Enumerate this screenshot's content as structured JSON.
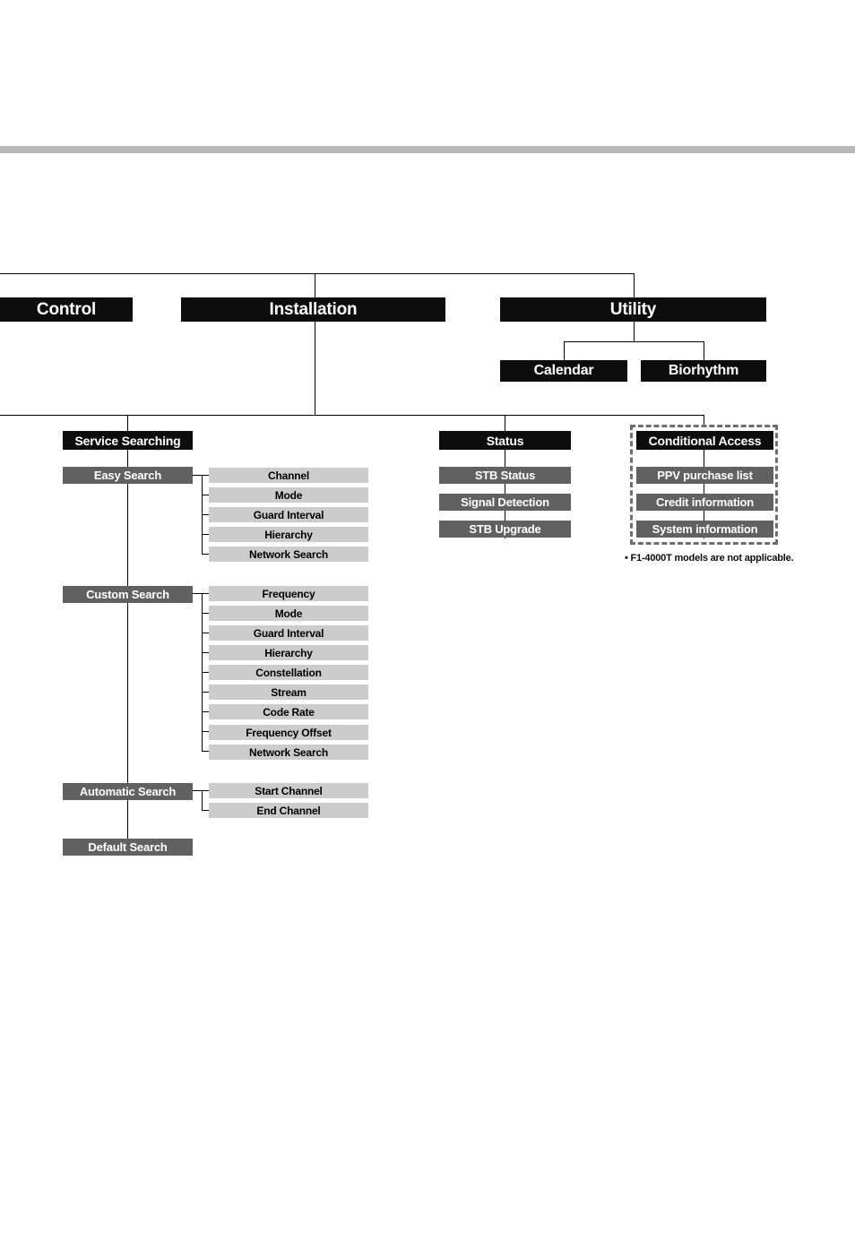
{
  "page": {
    "title": "Menu Structure Diagram",
    "colors": {
      "top_rule": "#b9b9b9",
      "node_black": "#0d0d0d",
      "node_dark_gray": "#616161",
      "node_light_gray": "#cccccc",
      "dashed_border": "#6e6e6e",
      "connector": "#000000"
    }
  },
  "top_level": {
    "control": "Control",
    "installation": "Installation",
    "utility": "Utility"
  },
  "utility_children": {
    "calendar": "Calendar",
    "biorhythm": "Biorhythm"
  },
  "installation": {
    "section_header": "Service Searching",
    "groups": [
      {
        "label": "Easy Search",
        "items": [
          "Channel",
          "Mode",
          "Guard Interval",
          "Hierarchy",
          "Network Search"
        ]
      },
      {
        "label": "Custom Search",
        "items": [
          "Frequency",
          "Mode",
          "Guard Interval",
          "Hierarchy",
          "Constellation",
          "Stream",
          "Code Rate",
          "Frequency Offset",
          "Network Search"
        ]
      },
      {
        "label": "Automatic Search",
        "items": [
          "Start Channel",
          "End Channel"
        ]
      },
      {
        "label": "Default Search",
        "items": []
      }
    ]
  },
  "status": {
    "section_header": "Status",
    "items": [
      "STB Status",
      "Signal Detection",
      "STB Upgrade"
    ]
  },
  "conditional_access": {
    "section_header": "Conditional Access",
    "items": [
      "PPV purchase list",
      "Credit information",
      "System information"
    ],
    "footnote": "• F1-4000T models are not applicable."
  }
}
